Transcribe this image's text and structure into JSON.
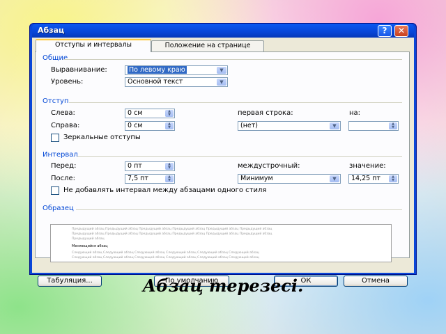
{
  "window": {
    "title": "Абзац",
    "help_glyph": "?",
    "close_glyph": "✕"
  },
  "tabs": [
    {
      "label": "Отступы и интервалы",
      "active": true
    },
    {
      "label": "Положение на странице",
      "active": false
    }
  ],
  "general": {
    "title": "Общие",
    "alignment": {
      "label": "Выравнивание:",
      "value": "По левому краю"
    },
    "level": {
      "label": "Уровень:",
      "value": "Основной текст"
    }
  },
  "indent": {
    "title": "Отступ",
    "left": {
      "label": "Слева:",
      "value": "0 см"
    },
    "right": {
      "label": "Справа:",
      "value": "0 см"
    },
    "first_line": {
      "label": "первая строка:",
      "value": "(нет)"
    },
    "by": {
      "label": "на:",
      "value": ""
    },
    "mirror": {
      "label": "Зеркальные отступы",
      "checked": false
    }
  },
  "spacing": {
    "title": "Интервал",
    "before": {
      "label": "Перед:",
      "value": "0 пт"
    },
    "after": {
      "label": "После:",
      "value": "7,5 пт"
    },
    "line": {
      "label": "междустрочный:",
      "value": "Минимум"
    },
    "at": {
      "label": "значение:",
      "value": "14,25 пт"
    },
    "dont_add": {
      "label": "Не добавлять интервал между абзацами одного стиля",
      "checked": false
    }
  },
  "preview": {
    "title": "Образец",
    "prev_text": "Предыдущий абзац Предыдущий абзац Предыдущий абзац Предыдущий абзац Предыдущий абзац Предыдущий абзац",
    "prev_text_2": "Предыдущий абзац Предыдущий абзац Предыдущий абзац Предыдущий абзац Предыдущий абзац Предыдущий абзац",
    "prev_text_3": "Предыдущий абзац",
    "current_text": "Меняющийся абзац",
    "next_text": "Следующий абзац Следующий абзац Следующий абзац Следующий абзац Следующий абзац Следующий абзац",
    "next_text_2": "Следующий абзац Следующий абзац Следующий абзац Следующий абзац Следующий абзац Следующий абзац"
  },
  "buttons": {
    "tabs": "Табуляция...",
    "default": "По умолчанию",
    "ok": "ОК",
    "cancel": "Отмена"
  },
  "caption": "Абзац терезесі."
}
